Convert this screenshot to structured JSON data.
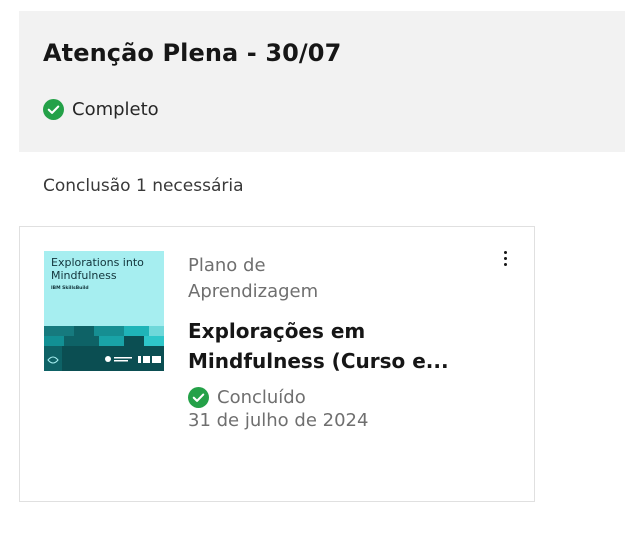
{
  "header": {
    "title": "Atenção Plena - 30/07",
    "status": "Completo"
  },
  "requirement": "Conclusão 1 necessária",
  "card": {
    "thumbnail": {
      "title_line1": "Explorations into",
      "title_line2": "Mindfulness",
      "brand": "IBM SkillsBuild"
    },
    "type_line1": "Plano de",
    "type_line2": "Aprendizagem",
    "title_line1": "Explorações em",
    "title_line2": "Mindfulness (Curso e...",
    "status": "Concluído",
    "date": "31 de julho de 2024",
    "more_icon": "overflow-menu-icon"
  },
  "colors": {
    "success": "#24a148",
    "header_bg": "#f2f2f2",
    "thumb_bg": "#a6eef0",
    "thumb_dark": "#0b4e52"
  }
}
